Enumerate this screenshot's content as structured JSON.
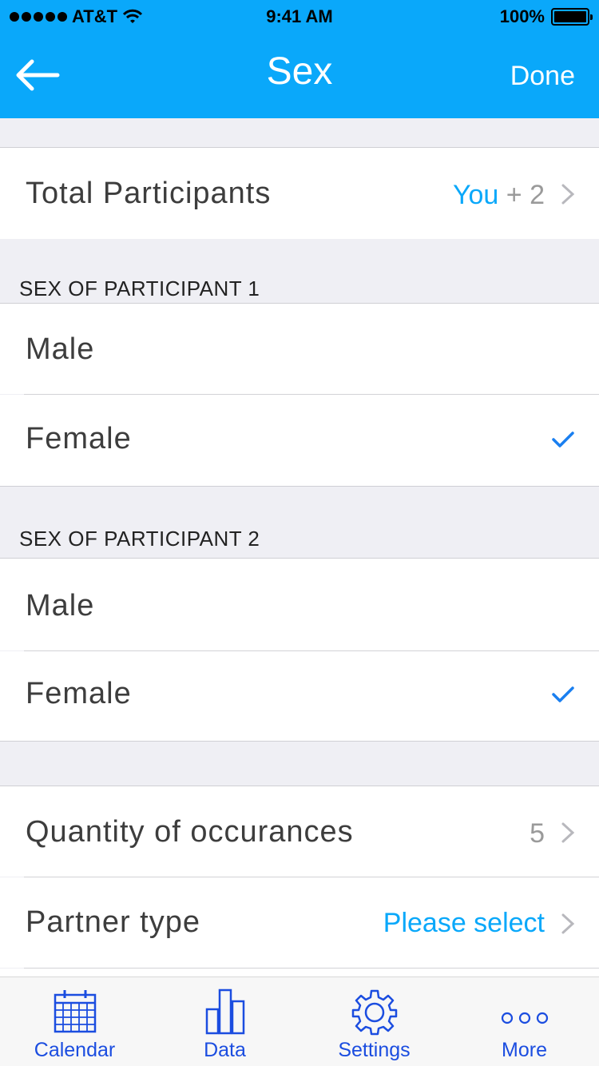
{
  "status_bar": {
    "carrier": "AT&T",
    "time": "9:41 AM",
    "battery": "100%"
  },
  "nav": {
    "title": "Sex",
    "done_label": "Done"
  },
  "total_participants": {
    "label": "Total Participants",
    "value_you": "You",
    "value_plus": "+ 2"
  },
  "participant1": {
    "header": "SEX OF PARTICIPANT 1",
    "options": [
      "Male",
      "Female"
    ],
    "selected": "Female"
  },
  "participant2": {
    "header": "SEX OF PARTICIPANT 2",
    "options": [
      "Male",
      "Female"
    ],
    "selected": "Female"
  },
  "quantity": {
    "label": "Quantity of occurances",
    "value": "5"
  },
  "partner_type": {
    "label": "Partner type",
    "value": "Please select"
  },
  "tabs": [
    {
      "label": "Calendar",
      "icon": "calendar-icon"
    },
    {
      "label": "Data",
      "icon": "bar-chart-icon"
    },
    {
      "label": "Settings",
      "icon": "gear-icon"
    },
    {
      "label": "More",
      "icon": "more-icon"
    }
  ],
  "colors": {
    "header": "#0aa8fa",
    "accent": "#0aa8fa",
    "check": "#1a7ff0",
    "tab": "#1b4de0"
  }
}
